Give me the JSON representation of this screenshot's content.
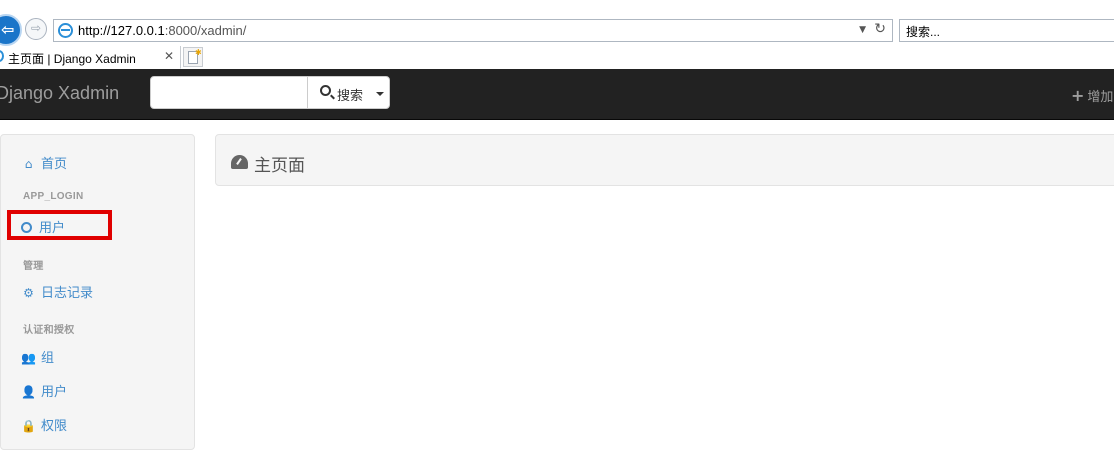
{
  "browser": {
    "address_host": "http://127.0.0.1",
    "address_rest": ":8000/xadmin/",
    "search_placeholder": "搜索...",
    "tab_title": "主页面 | Django Xadmin"
  },
  "navbar": {
    "brand": "Django Xadmin",
    "search_value": "",
    "search_button_label": "搜索",
    "add_label": "增加"
  },
  "sidebar": {
    "home_label": "首页",
    "sections": [
      {
        "heading": "APP_LOGIN",
        "items": [
          {
            "label": "用户",
            "icon": "circle-icon"
          }
        ]
      },
      {
        "heading": "管理",
        "items": [
          {
            "label": "日志记录",
            "icon": "gear-icon"
          }
        ]
      },
      {
        "heading": "认证和授权",
        "items": [
          {
            "label": "组",
            "icon": "group-icon"
          },
          {
            "label": "用户",
            "icon": "user-icon"
          },
          {
            "label": "权限",
            "icon": "lock-icon"
          }
        ]
      }
    ],
    "highlight_color": "#e00000",
    "link_color": "#428bca"
  },
  "main": {
    "title": "主页面"
  },
  "colors": {
    "navbar_bg": "#222222",
    "panel_bg": "#f5f5f5"
  }
}
